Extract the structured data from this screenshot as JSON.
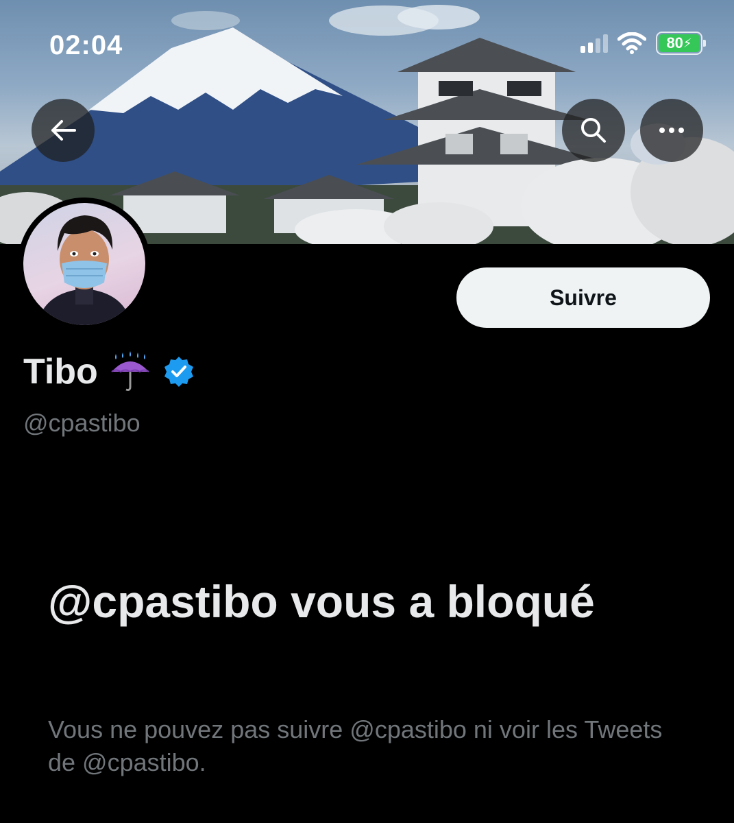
{
  "status_bar": {
    "time": "02:04",
    "battery_percent": "80",
    "battery_level": 0.8,
    "signal_bars_active": 2,
    "signal_bars_total": 4
  },
  "header": {
    "back_icon": "arrow-left-icon",
    "search_icon": "search-icon",
    "more_icon": "ellipsis-icon"
  },
  "profile": {
    "display_name": "Tibo",
    "name_emoji": "☔",
    "verified_icon": "verified-badge-icon",
    "handle": "@cpastibo",
    "follow_label": "Suivre"
  },
  "blocked": {
    "title": "@cpastibo vous a bloqué",
    "description": "Vous ne pouvez pas suivre @cpastibo ni voir les Tweets de @cpastibo."
  },
  "colors": {
    "background": "#000000",
    "follow_button_bg": "#eff3f4",
    "muted_text": "#71767b",
    "verified_blue": "#1d9bf0",
    "battery_green": "#36c759"
  }
}
